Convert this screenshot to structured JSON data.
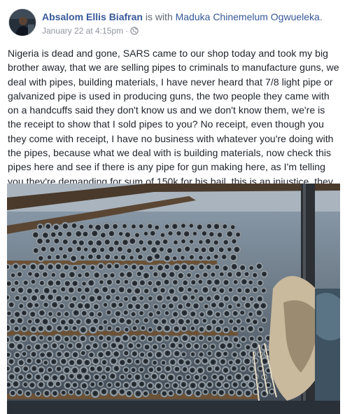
{
  "post": {
    "author": "Absalom Ellis Biafran",
    "with_text": "is with",
    "tagged_user": "Maduka Chinemelum Ogwueleka",
    "tagged_suffix": ".",
    "date": "January 22 at 4:15pm",
    "separator": "·",
    "privacy_icon": "globe-icon",
    "body": "Nigeria is dead and gone, SARS came to our shop today and took my big brother away, that we are selling pipes to criminals to manufacture guns, we deal with pipes, building materials, I have never heard that 7/8 light pipe or galvanized pipe is used in producing guns, the two people they came with on a handcuffs said they don't know us and we don't know them, we're is the receipt to show that I sold pipes to you? No receipt, even though you they come with receipt, I have no business with whatever you're doing with the pipes, because what we deal with is building materials, now check this pipes here and see if there is any pipe for gun making here, as I'm telling you they're demanding for sum of 150k for his bail, this is an injustice, they didn't even allow him to call his lawyer, they seized his phone, now they called me to come and meet them in their office with his lawyer, I called the lawyer he said he can't make it today, that simply means he is going to sleep there for the crime we know nothing about. Nigeria is a frustration."
  },
  "colors": {
    "link": "#365899",
    "text": "#1d2129",
    "meta": "#90949c"
  }
}
